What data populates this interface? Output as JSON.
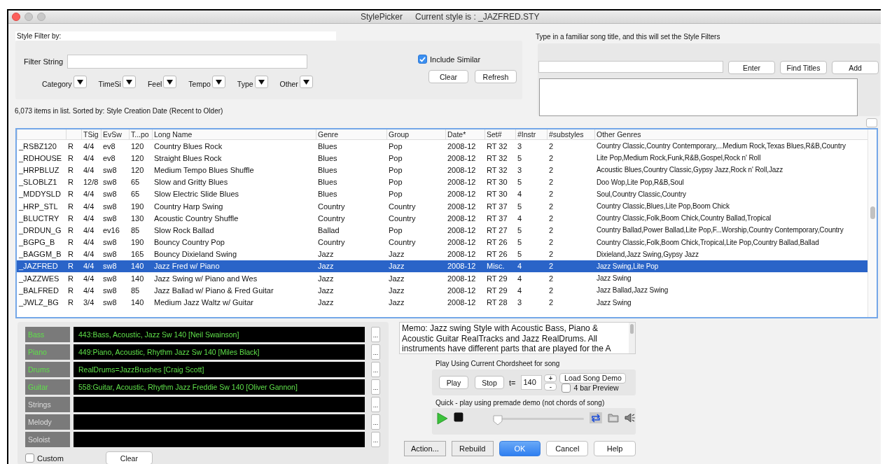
{
  "window": {
    "title": "StylePicker",
    "subtitle": "Current style is : _JAZFRED.STY"
  },
  "style_filter": {
    "heading": "Style Filter by:",
    "filter_label": "Filter String",
    "dropdowns": [
      "Category",
      "TimeSi",
      "Feel",
      "Tempo",
      "Type",
      "Other"
    ],
    "include_similar": {
      "label": "Include Similar",
      "checked": true
    },
    "buttons": [
      "Clear",
      "Refresh"
    ]
  },
  "status": "6,073 items in list. Sorted by: Style Creation Date  (Recent to Older)",
  "song_title": {
    "heading": "Type in a familiar song title, and this will set the Style Filters",
    "buttons": [
      "Enter",
      "Find Titles",
      "Add"
    ]
  },
  "table": {
    "columns": [
      {
        "kind": "blank"
      },
      {
        "kind": "blank"
      },
      {
        "kind": "text",
        "label": "TSig"
      },
      {
        "kind": "text",
        "label": "EvSw"
      },
      {
        "kind": "text",
        "label": "T...po"
      },
      {
        "kind": "text",
        "label": "Long Name"
      },
      {
        "kind": "text",
        "label": "Genre"
      },
      {
        "kind": "text",
        "label": "Group"
      },
      {
        "kind": "text",
        "label": "Date*"
      },
      {
        "kind": "text",
        "label": "Set#"
      },
      {
        "kind": "text",
        "label": "#Instr"
      },
      {
        "kind": "text",
        "label": "#substyles"
      },
      {
        "kind": "text",
        "label": "Other Genres"
      }
    ],
    "rows": [
      {
        "selected": false,
        "cells": [
          "_RSBZ120",
          "R",
          "4/4",
          "ev8",
          "120",
          "Country Blues Rock",
          "Blues",
          "Pop",
          "2008-12",
          "RT 32",
          "3",
          "2",
          "Country Classic,Country Contemporary,...Medium Rock,Texas Blues,R&B,Country"
        ]
      },
      {
        "selected": false,
        "cells": [
          "_RDHOUSE",
          "R",
          "4/4",
          "ev8",
          "120",
          "Straight Blues Rock",
          "Blues",
          "Pop",
          "2008-12",
          "RT 32",
          "5",
          "2",
          "Lite Pop,Medium Rock,Funk,R&B,Gospel,Rock n' Roll"
        ]
      },
      {
        "selected": false,
        "cells": [
          "_HRPBLUZ",
          "R",
          "4/4",
          "sw8",
          "120",
          "Medium Tempo Blues Shuffle",
          "Blues",
          "Pop",
          "2008-12",
          "RT 32",
          "3",
          "2",
          "Acoustic Blues,Country Classic,Gypsy Jazz,Rock n' Roll,Jazz"
        ]
      },
      {
        "selected": false,
        "cells": [
          "_SLOBLZ1",
          "R",
          "12/8",
          "sw8",
          "65",
          "Slow and Gritty Blues",
          "Blues",
          "Pop",
          "2008-12",
          "RT 30",
          "5",
          "2",
          "Doo Wop,Lite Pop,R&B,Soul"
        ]
      },
      {
        "selected": false,
        "cells": [
          "_MDDYSLD",
          "R",
          "4/4",
          "sw8",
          "65",
          "Slow Electric Slide Blues",
          "Blues",
          "Pop",
          "2008-12",
          "RT 30",
          "4",
          "2",
          "Soul,Country Classic,Country"
        ]
      },
      {
        "selected": false,
        "cells": [
          "_HRP_STL",
          "R",
          "4/4",
          "sw8",
          "190",
          "Country Harp Swing",
          "Country",
          "Country",
          "2008-12",
          "RT 37",
          "5",
          "2",
          "Country Classic,Blues,Lite Pop,Boom Chick"
        ]
      },
      {
        "selected": false,
        "cells": [
          "_BLUCTRY",
          "R",
          "4/4",
          "sw8",
          "130",
          "Acoustic Country Shuffle",
          "Country",
          "Country",
          "2008-12",
          "RT 37",
          "4",
          "2",
          "Country Classic,Folk,Boom Chick,Country Ballad,Tropical"
        ]
      },
      {
        "selected": false,
        "cells": [
          "_DRDUN_G",
          "R",
          "4/4",
          "ev16",
          "85",
          "Slow Rock Ballad",
          "Ballad",
          "Pop",
          "2008-12",
          "RT 27",
          "5",
          "2",
          "Country Ballad,Power Ballad,Lite Pop,F...Worship,Country Contemporary,Country"
        ]
      },
      {
        "selected": false,
        "cells": [
          "_BGPG_B",
          "R",
          "4/4",
          "sw8",
          "190",
          "Bouncy Country Pop",
          "Country",
          "Country",
          "2008-12",
          "RT 26",
          "5",
          "2",
          "Country Classic,Folk,Boom Chick,Tropical,Lite Pop,Country Ballad,Ballad"
        ]
      },
      {
        "selected": false,
        "cells": [
          "_BAGGM_B",
          "R",
          "4/4",
          "sw8",
          "165",
          "Bouncy Dixieland Swing",
          "Jazz",
          "Jazz",
          "2008-12",
          "RT 26",
          "5",
          "2",
          "Dixieland,Jazz Swing,Gypsy Jazz"
        ]
      },
      {
        "selected": true,
        "cells": [
          "_JAZFRED",
          "R",
          "4/4",
          "sw8",
          "140",
          "Jazz Fred w/ Piano",
          "Jazz",
          "Jazz",
          "2008-12",
          "Misc.",
          "4",
          "2",
          "Jazz Swing,Lite Pop"
        ]
      },
      {
        "selected": false,
        "cells": [
          "_JAZZWES",
          "R",
          "4/4",
          "sw8",
          "140",
          "Jazz Swing w/ Piano and Wes",
          "Jazz",
          "Jazz",
          "2008-12",
          "RT 29",
          "4",
          "2",
          "Jazz Swing"
        ]
      },
      {
        "selected": false,
        "cells": [
          "_BALFRED",
          "R",
          "4/4",
          "sw8",
          "85",
          "Jazz Ballad w/ Piano & Fred Guitar",
          "Jazz",
          "Jazz",
          "2008-12",
          "RT 29",
          "4",
          "2",
          "Jazz Ballad,Jazz Swing"
        ]
      },
      {
        "selected": false,
        "cells": [
          "_JWLZ_BG",
          "R",
          "3/4",
          "sw8",
          "140",
          "Medium Jazz Waltz w/ Guitar",
          "Jazz",
          "Jazz",
          "2008-12",
          "RT 28",
          "3",
          "2",
          "Jazz Swing"
        ]
      }
    ]
  },
  "instruments": [
    {
      "name": "Bass",
      "assigned": true,
      "patch": "443:Bass, Acoustic, Jazz Sw 140 [Neil Swainson]",
      "more": "..."
    },
    {
      "name": "Piano",
      "assigned": true,
      "patch": "449:Piano, Acoustic, Rhythm Jazz Sw 140 [Miles Black]",
      "more": "..."
    },
    {
      "name": "Drums",
      "assigned": true,
      "patch": "RealDrums=JazzBrushes [Craig Scott]",
      "more": "..."
    },
    {
      "name": "Guitar",
      "assigned": true,
      "patch": "558:Guitar, Acoustic, Rhythm Jazz Freddie Sw 140 [Oliver Gannon]",
      "more": "..."
    },
    {
      "name": "Strings",
      "assigned": false,
      "more": "..."
    },
    {
      "name": "Melody",
      "assigned": false,
      "more": "..."
    },
    {
      "name": "Soloist",
      "assigned": false,
      "more": "..."
    }
  ],
  "custom": {
    "label": "Custom",
    "checked": false
  },
  "instruments_clear": "Clear",
  "memo": "Memo: Jazz swing Style with Acoustic Bass, Piano & Acoustic Guitar RealTracks and Jazz RealDrums. All instruments have different parts that are played for the A",
  "play_current": {
    "heading": "Play Using Current Chordsheet for song",
    "play": "Play",
    "stop": "Stop",
    "tempo_label": "t=",
    "tempo": "140",
    "plus": "+",
    "minus": "-",
    "load_demo": "Load Song Demo",
    "preview": {
      "label": "4 bar Preview",
      "checked": false
    }
  },
  "quick_demo": {
    "heading": "Quick - play using premade demo (not chords of song)",
    "level": 0
  },
  "buttons": [
    {
      "label": "Action...",
      "kind": "square"
    },
    {
      "label": "Rebuild",
      "kind": "square"
    },
    {
      "label": "OK",
      "kind": "default"
    },
    {
      "label": "Cancel",
      "kind": "rounded"
    },
    {
      "label": "Help",
      "kind": "rounded"
    }
  ]
}
